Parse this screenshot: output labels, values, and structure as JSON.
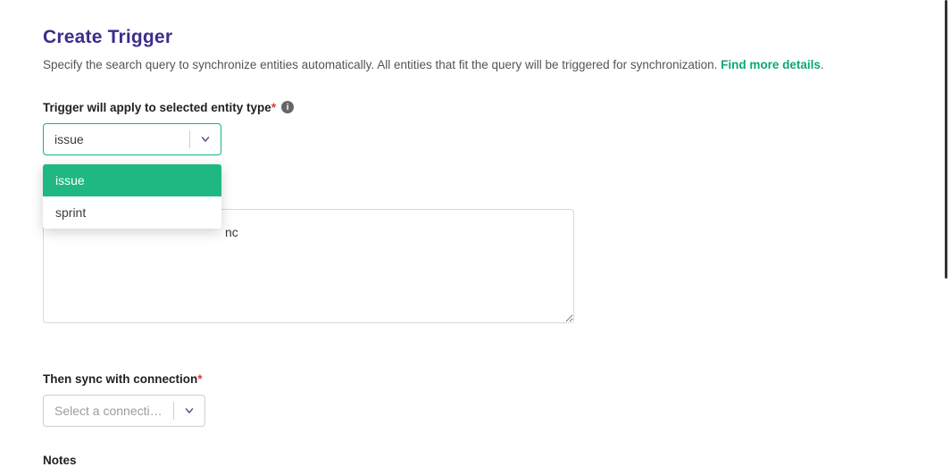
{
  "title": "Create Trigger",
  "description": "Specify the search query to synchronize entities automatically. All entities that fit the query will be triggered for synchronization. ",
  "link_text": "Find more details",
  "entity_type": {
    "label": "Trigger will apply to selected entity type",
    "value": "issue",
    "options": [
      "issue",
      "sprint"
    ]
  },
  "query_visible_fragment": "nc",
  "connection": {
    "label": "Then sync with connection",
    "placeholder": "Select a connection"
  },
  "notes_label": "Notes"
}
